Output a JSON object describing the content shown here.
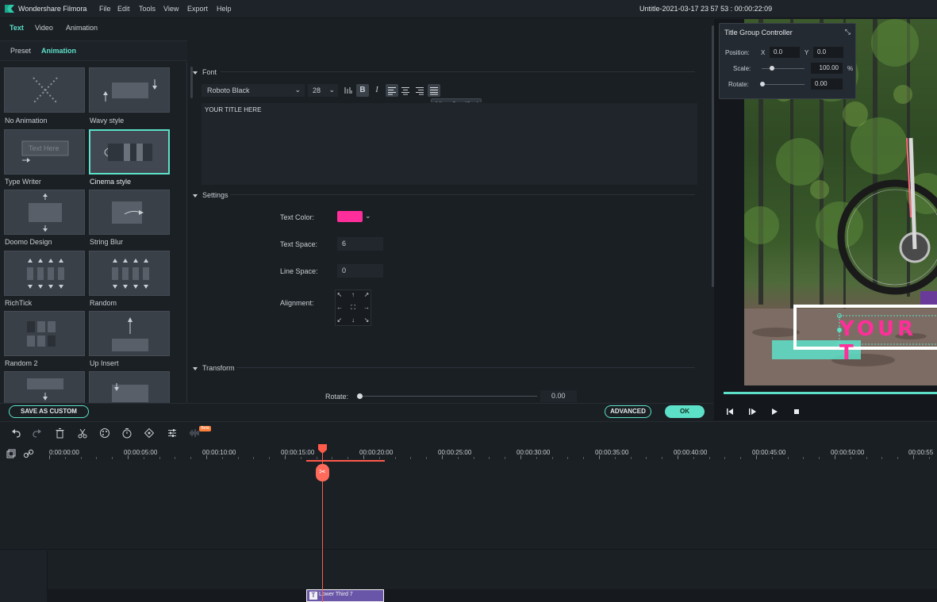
{
  "app": {
    "name": "Wondershare Filmora",
    "menu": [
      "File",
      "Edit",
      "Tools",
      "View",
      "Export",
      "Help"
    ],
    "project_title": "Untitle-2021-03-17 23 57 53 : 00:00:22:09"
  },
  "main_tabs": [
    "Text",
    "Video",
    "Animation"
  ],
  "sub_tabs": [
    "Preset",
    "Animation"
  ],
  "library": {
    "items": [
      "No Animation",
      "Wavy style",
      "Type Writer",
      "Cinema style",
      "Doomo Design",
      "String Blur",
      "RichTick",
      "Random",
      "Random 2",
      "Up Insert"
    ],
    "selected": "Cinema style",
    "type_writer_preview_text": "Text Here"
  },
  "editor": {
    "font_section": "Font",
    "font_family": "Roboto Black",
    "font_size": "28",
    "tooltip": "Align Justified",
    "text_value": "YOUR TITLE HERE",
    "settings_section": "Settings",
    "text_color_label": "Text Color:",
    "text_color": "#ff2e9a",
    "text_space_label": "Text Space:",
    "text_space": "6",
    "line_space_label": "Line Space:",
    "line_space": "0",
    "alignment_label": "Alignment:",
    "transform_section": "Transform",
    "rotate_label": "Rotate:",
    "rotate_value": "0.00"
  },
  "actions": {
    "save_custom": "SAVE AS CUSTOM",
    "advanced": "ADVANCED",
    "ok": "OK"
  },
  "title_group_controller": {
    "title": "Title Group Controller",
    "position_label": "Position:",
    "x_label": "X",
    "x_value": "0.0",
    "y_label": "Y",
    "y_value": "0.0",
    "scale_label": "Scale:",
    "scale_value": "100.00",
    "scale_unit": "%",
    "rotate_label": "Rotate:",
    "rotate_value": "0.00"
  },
  "preview": {
    "title_text": "YOUR T"
  },
  "timeline": {
    "ruler": [
      "0:00:00:00",
      "00:00:05:00",
      "00:00:10:00",
      "00:00:15:00",
      "00:00:20:00",
      "00:00:25:00",
      "00:00:30:00",
      "00:00:35:00",
      "00:00:40:00",
      "00:00:45:00",
      "00:00:50:00",
      "00:00:55"
    ],
    "beta_badge": "Beta",
    "clip_label": "Lower Third 7",
    "clip_icon": "T"
  },
  "colors": {
    "accent": "#5ce1c8",
    "playhead": "#ff5a4a",
    "clip": "#6a56a8",
    "title_pink": "#ff2e9a"
  }
}
